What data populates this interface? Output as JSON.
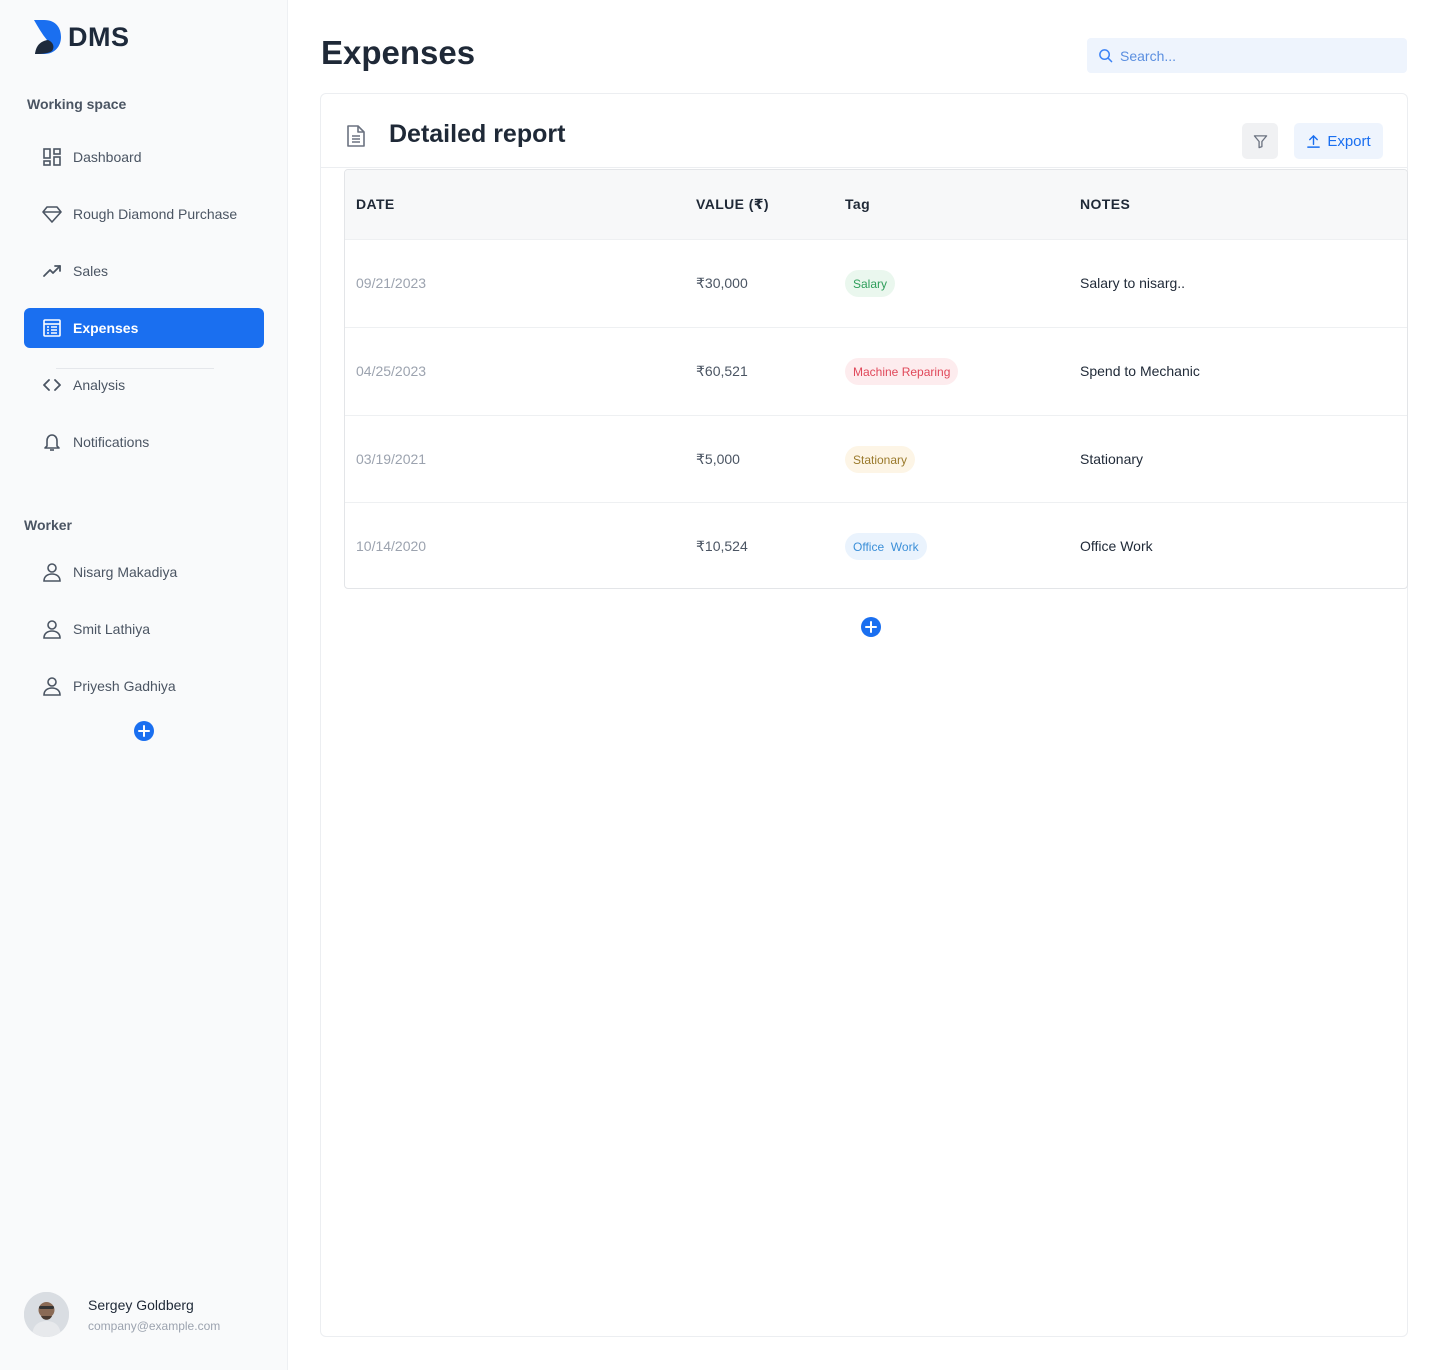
{
  "app": {
    "logo_text": "DMS"
  },
  "sidebar": {
    "working_space_label": "Working space",
    "items": [
      {
        "label": "Dashboard",
        "icon": "dashboard-icon",
        "active": false
      },
      {
        "label": "Rough Diamond Purchase",
        "icon": "diamond-icon",
        "active": false
      },
      {
        "label": "Sales",
        "icon": "trending-up-icon",
        "active": false
      },
      {
        "label": "Expenses",
        "icon": "receipt-icon",
        "active": true
      },
      {
        "label": "Analysis",
        "icon": "code-icon",
        "active": false
      },
      {
        "label": "Notifications",
        "icon": "bell-icon",
        "active": false
      }
    ],
    "worker_label": "Worker",
    "workers": [
      {
        "name": "Nisarg Makadiya",
        "icon": "user-icon"
      },
      {
        "name": "Smit Lathiya",
        "icon": "user-icon"
      },
      {
        "name": "Priyesh Gadhiya",
        "icon": "user-icon"
      }
    ],
    "user": {
      "name": "Sergey Goldberg",
      "email": "company@example.com"
    }
  },
  "header": {
    "title": "Expenses",
    "search": {
      "placeholder": "Search...",
      "value": ""
    }
  },
  "report": {
    "title": "Detailed report",
    "export_label": "Export",
    "columns": [
      "DATE",
      "VALUE (₹)",
      "Tag",
      "NOTES"
    ],
    "rows": [
      {
        "date": "09/21/2023",
        "value": "₹30,000",
        "tag": "Salary",
        "notes": "Salary to nisarg.."
      },
      {
        "date": "04/25/2023",
        "value": "₹60,521",
        "tag": "Machine Reparing",
        "notes": "Spend to Mechanic"
      },
      {
        "date": "03/19/2021",
        "value": "₹5,000",
        "tag": "Stationary",
        "notes": "Stationary"
      },
      {
        "date": "10/14/2020",
        "value": "₹10,524",
        "tag": "Office  Work",
        "notes": "Office Work"
      }
    ]
  },
  "colors": {
    "accent": "#1a6ff0",
    "tag_salary_bg": "#eaf7ee",
    "tag_salary_fg": "#2f9e5b",
    "tag_machine_bg": "#fdecee",
    "tag_machine_fg": "#e0485a",
    "tag_stationary_bg": "#fdf5e6",
    "tag_stationary_fg": "#9a7a2c",
    "tag_office_bg": "#eaf3fd",
    "tag_office_fg": "#3b8fd8"
  }
}
